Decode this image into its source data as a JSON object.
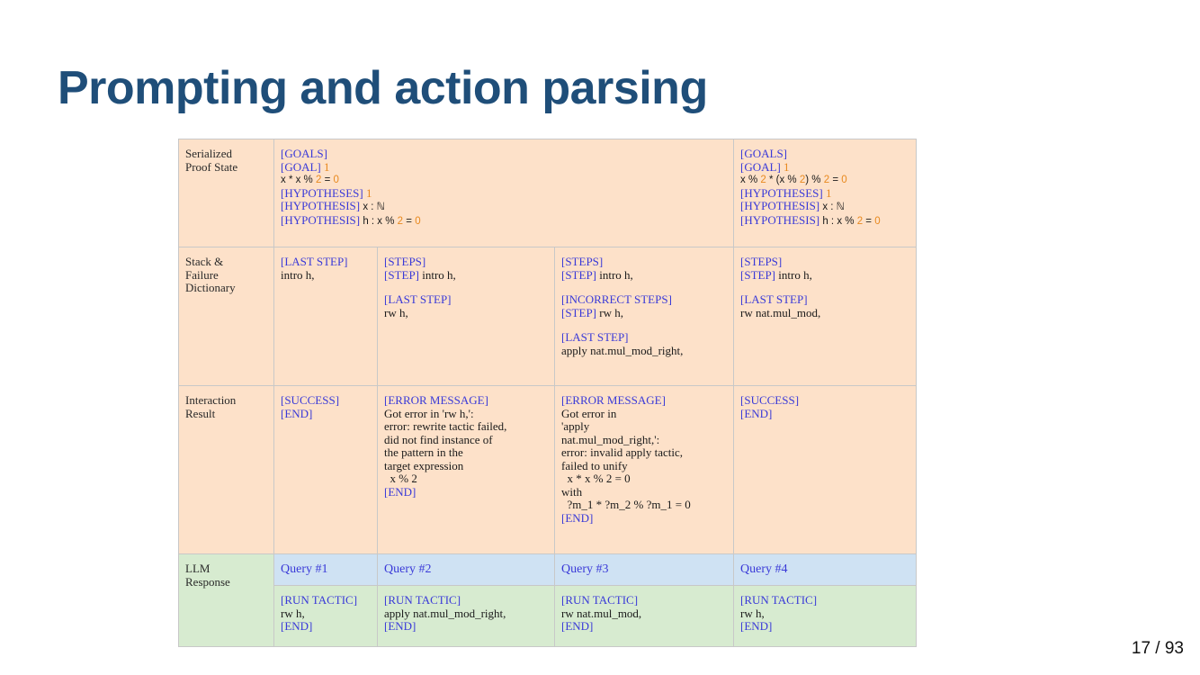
{
  "slide": {
    "title": "Prompting and action parsing",
    "page": "17 / 93"
  },
  "figure": {
    "row_labels": {
      "state": [
        "Serialized",
        "Proof State"
      ],
      "stack": [
        "Stack &",
        "Failure",
        "Dictionary"
      ],
      "result": [
        "Interaction",
        "Result"
      ],
      "llm": [
        "LLM",
        "Response"
      ]
    },
    "state_main": {
      "goals_tag": "[GOALS]",
      "goal_tag": "[GOAL]",
      "goal_num": "1",
      "eq_a": "x * x % ",
      "eq_n1": "2",
      "eq_b": " = ",
      "eq_n2": "0",
      "hyps_tag": "[HYPOTHESES]",
      "hyps_num": "1",
      "hyp1_tag": "[HYPOTHESIS]",
      "hyp1_text": " x : ℕ",
      "hyp2_tag": "[HYPOTHESIS]",
      "hyp2_a": " h : x % ",
      "hyp2_n1": "2",
      "hyp2_b": " = ",
      "hyp2_n2": "0"
    },
    "state_right": {
      "goals_tag": "[GOALS]",
      "goal_tag": "[GOAL]",
      "goal_num": "1",
      "eq_a": "x % ",
      "eq_n1": "2",
      "eq_b": " * (x % ",
      "eq_n2": "2",
      "eq_c": ") % ",
      "eq_n3": "2",
      "eq_d": " = ",
      "eq_n4": "0",
      "hyps_tag": "[HYPOTHESES]",
      "hyps_num": "1",
      "hyp1_tag": "[HYPOTHESIS]",
      "hyp1_text": " x : ℕ",
      "hyp2_tag": "[HYPOTHESIS]",
      "hyp2_a": " h : x % ",
      "hyp2_n1": "2",
      "hyp2_b": " = ",
      "hyp2_n2": "0"
    },
    "stack": {
      "c1": {
        "last_tag": "[LAST STEP]",
        "last_text": "intro h,"
      },
      "c2": {
        "steps_tag": "[STEPS]",
        "step_tag": "[STEP]",
        "step_text": " intro h,",
        "last_tag": "[LAST STEP]",
        "last_text": "rw h,"
      },
      "c3": {
        "steps_tag": "[STEPS]",
        "step_tag": "[STEP]",
        "step_text": " intro h,",
        "incorrect_tag": "[INCORRECT STEPS]",
        "istep_tag": "[STEP]",
        "istep_text": " rw h,",
        "last_tag": "[LAST STEP]",
        "last_text": "apply nat.mul_mod_right,"
      },
      "c4": {
        "steps_tag": "[STEPS]",
        "step_tag": "[STEP]",
        "step_text": " intro h,",
        "last_tag": "[LAST STEP]",
        "last_text": "rw nat.mul_mod,"
      }
    },
    "result": {
      "c1": {
        "success_tag": "[SUCCESS]",
        "end_tag": "[END]"
      },
      "c2": {
        "err_tag": "[ERROR MESSAGE]",
        "lines": [
          "Got error in 'rw h,':",
          "error: rewrite tactic failed,",
          "did not find instance of",
          "the pattern in the",
          "target expression",
          "  x % 2"
        ],
        "end_tag": "[END]"
      },
      "c3": {
        "err_tag": "[ERROR MESSAGE]",
        "lines": [
          "Got error in",
          "'apply",
          "nat.mul_mod_right,':",
          "error: invalid apply tactic,",
          "failed to unify",
          "  x * x % 2 = 0",
          "with",
          "  ?m_1 * ?m_2 % ?m_1 = 0"
        ],
        "end_tag": "[END]"
      },
      "c4": {
        "success_tag": "[SUCCESS]",
        "end_tag": "[END]"
      }
    },
    "queries": [
      "Query #1",
      "Query #2",
      "Query #3",
      "Query #4"
    ],
    "responses": [
      {
        "run_tag": "[RUN TACTIC]",
        "tactic": "rw h,",
        "end_tag": "[END]"
      },
      {
        "run_tag": "[RUN TACTIC]",
        "tactic": "apply nat.mul_mod_right,",
        "end_tag": "[END]"
      },
      {
        "run_tag": "[RUN TACTIC]",
        "tactic": "rw nat.mul_mod,",
        "end_tag": "[END]"
      },
      {
        "run_tag": "[RUN TACTIC]",
        "tactic": "rw h,",
        "end_tag": "[END]"
      }
    ],
    "colors": {
      "title": "#1f4e79",
      "tag": "#3a3ad8",
      "number": "#e8891e",
      "peach": "#fde1c9",
      "green": "#d7ebd0",
      "blue": "#cfe2f3"
    }
  }
}
